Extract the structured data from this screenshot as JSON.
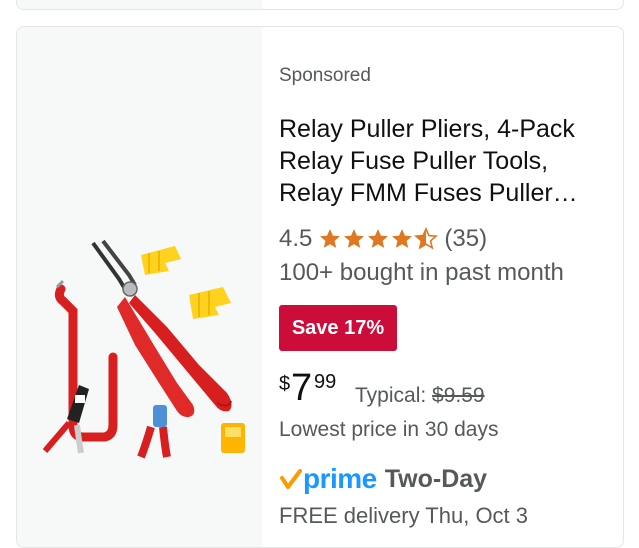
{
  "product": {
    "sponsored_label": "Sponsored",
    "title_lines": [
      "Relay Puller Pliers, 4-Pack",
      "Relay Fuse Puller Tools,",
      "Relay FMM Fuses Puller…"
    ],
    "rating_value": "4.5",
    "rating_stars": 4.5,
    "review_count": "(35)",
    "bought_text": "100+ bought in past month",
    "save_badge": "Save 17%",
    "price": {
      "currency": "$",
      "whole": "7",
      "fraction": "99"
    },
    "typical_label": "Typical:",
    "typical_price": "$9.59",
    "lowest_price_text": "Lowest price in 30 days",
    "prime_label": "prime",
    "delivery_speed": "Two-Day",
    "cutoff_text": "FREE delivery Thu, Oct 3"
  },
  "colors": {
    "badge": "#cc0c39",
    "star": "#de7921",
    "prime_blue": "#1a98ff",
    "prime_check": "#ff9900",
    "pliers_handle": "#d81f1f",
    "clip_yellow": "#ffd21f"
  },
  "icons": [
    "star-icon",
    "half-star-icon",
    "prime-check-icon"
  ]
}
